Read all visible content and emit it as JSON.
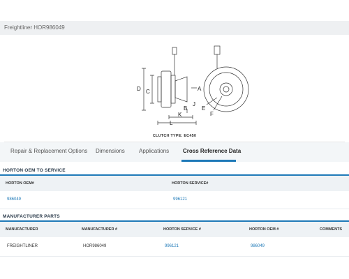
{
  "page": {
    "title": "Freightliner HOR986049"
  },
  "diagram": {
    "caption": "CLUTCH TYPE: EC450",
    "labels": {
      "a": "A",
      "b": "B",
      "c": "C",
      "d": "D",
      "e": "E",
      "f": "F",
      "j": "J",
      "k": "K",
      "l": "L"
    }
  },
  "tabs": [
    {
      "label": "Repair & Replacement Options"
    },
    {
      "label": "Applications"
    },
    {
      "label": "Dimensions"
    },
    {
      "label": "Cross Reference Data"
    }
  ],
  "oem_section": {
    "title": "HORTON OEM TO SERVICE",
    "headers": [
      "HORTON OEM#",
      "HORTON SERVICE#"
    ],
    "row": [
      "986049",
      "996121"
    ]
  },
  "mfr_section": {
    "title": "MANUFACTURER PARTS",
    "headers": [
      "MANUFACTURER",
      "MANUFACTURER #",
      "HORTON SERVICE #",
      "HORTON OEM #",
      "COMMENTS"
    ],
    "row": [
      "FREIGHTLINER",
      "HOR986049",
      "996121",
      "986049",
      ""
    ]
  }
}
